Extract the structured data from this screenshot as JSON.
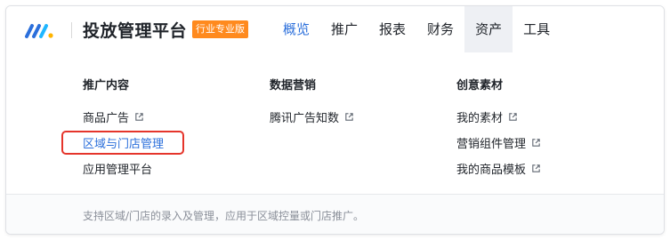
{
  "header": {
    "title": "投放管理平台",
    "badge": "行业专业版"
  },
  "nav": [
    {
      "label": "概览",
      "state": "active"
    },
    {
      "label": "推广",
      "state": ""
    },
    {
      "label": "报表",
      "state": ""
    },
    {
      "label": "财务",
      "state": ""
    },
    {
      "label": "资产",
      "state": "hover"
    },
    {
      "label": "工具",
      "state": ""
    }
  ],
  "menu": {
    "columns": [
      {
        "title": "推广内容",
        "items": [
          {
            "label": "商品广告",
            "external": true
          },
          {
            "label": "区域与门店管理",
            "external": false,
            "highlighted": true
          },
          {
            "label": "应用管理平台",
            "external": false
          }
        ]
      },
      {
        "title": "数据营销",
        "items": [
          {
            "label": "腾讯广告知数",
            "external": true
          }
        ]
      },
      {
        "title": "创意素材",
        "items": [
          {
            "label": "我的素材",
            "external": true
          },
          {
            "label": "营销组件管理",
            "external": true
          },
          {
            "label": "我的商品模板",
            "external": true
          }
        ]
      }
    ]
  },
  "footer": {
    "description": "支持区域/门店的录入及管理，应用于区域控量或门店推广。"
  },
  "colors": {
    "accent": "#2b6fdb",
    "badge": "#ff8a1e",
    "highlight_border": "#e5352b"
  }
}
